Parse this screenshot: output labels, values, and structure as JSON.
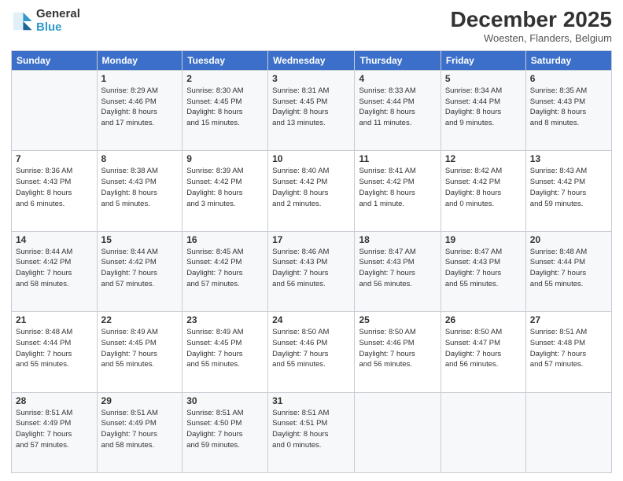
{
  "logo": {
    "general": "General",
    "blue": "Blue"
  },
  "title": {
    "main": "December 2025",
    "sub": "Woesten, Flanders, Belgium"
  },
  "calendar": {
    "headers": [
      "Sunday",
      "Monday",
      "Tuesday",
      "Wednesday",
      "Thursday",
      "Friday",
      "Saturday"
    ],
    "weeks": [
      [
        {
          "day": "",
          "info": ""
        },
        {
          "day": "1",
          "info": "Sunrise: 8:29 AM\nSunset: 4:46 PM\nDaylight: 8 hours\nand 17 minutes."
        },
        {
          "day": "2",
          "info": "Sunrise: 8:30 AM\nSunset: 4:45 PM\nDaylight: 8 hours\nand 15 minutes."
        },
        {
          "day": "3",
          "info": "Sunrise: 8:31 AM\nSunset: 4:45 PM\nDaylight: 8 hours\nand 13 minutes."
        },
        {
          "day": "4",
          "info": "Sunrise: 8:33 AM\nSunset: 4:44 PM\nDaylight: 8 hours\nand 11 minutes."
        },
        {
          "day": "5",
          "info": "Sunrise: 8:34 AM\nSunset: 4:44 PM\nDaylight: 8 hours\nand 9 minutes."
        },
        {
          "day": "6",
          "info": "Sunrise: 8:35 AM\nSunset: 4:43 PM\nDaylight: 8 hours\nand 8 minutes."
        }
      ],
      [
        {
          "day": "7",
          "info": "Sunrise: 8:36 AM\nSunset: 4:43 PM\nDaylight: 8 hours\nand 6 minutes."
        },
        {
          "day": "8",
          "info": "Sunrise: 8:38 AM\nSunset: 4:43 PM\nDaylight: 8 hours\nand 5 minutes."
        },
        {
          "day": "9",
          "info": "Sunrise: 8:39 AM\nSunset: 4:42 PM\nDaylight: 8 hours\nand 3 minutes."
        },
        {
          "day": "10",
          "info": "Sunrise: 8:40 AM\nSunset: 4:42 PM\nDaylight: 8 hours\nand 2 minutes."
        },
        {
          "day": "11",
          "info": "Sunrise: 8:41 AM\nSunset: 4:42 PM\nDaylight: 8 hours\nand 1 minute."
        },
        {
          "day": "12",
          "info": "Sunrise: 8:42 AM\nSunset: 4:42 PM\nDaylight: 8 hours\nand 0 minutes."
        },
        {
          "day": "13",
          "info": "Sunrise: 8:43 AM\nSunset: 4:42 PM\nDaylight: 7 hours\nand 59 minutes."
        }
      ],
      [
        {
          "day": "14",
          "info": "Sunrise: 8:44 AM\nSunset: 4:42 PM\nDaylight: 7 hours\nand 58 minutes."
        },
        {
          "day": "15",
          "info": "Sunrise: 8:44 AM\nSunset: 4:42 PM\nDaylight: 7 hours\nand 57 minutes."
        },
        {
          "day": "16",
          "info": "Sunrise: 8:45 AM\nSunset: 4:42 PM\nDaylight: 7 hours\nand 57 minutes."
        },
        {
          "day": "17",
          "info": "Sunrise: 8:46 AM\nSunset: 4:43 PM\nDaylight: 7 hours\nand 56 minutes."
        },
        {
          "day": "18",
          "info": "Sunrise: 8:47 AM\nSunset: 4:43 PM\nDaylight: 7 hours\nand 56 minutes."
        },
        {
          "day": "19",
          "info": "Sunrise: 8:47 AM\nSunset: 4:43 PM\nDaylight: 7 hours\nand 55 minutes."
        },
        {
          "day": "20",
          "info": "Sunrise: 8:48 AM\nSunset: 4:44 PM\nDaylight: 7 hours\nand 55 minutes."
        }
      ],
      [
        {
          "day": "21",
          "info": "Sunrise: 8:48 AM\nSunset: 4:44 PM\nDaylight: 7 hours\nand 55 minutes."
        },
        {
          "day": "22",
          "info": "Sunrise: 8:49 AM\nSunset: 4:45 PM\nDaylight: 7 hours\nand 55 minutes."
        },
        {
          "day": "23",
          "info": "Sunrise: 8:49 AM\nSunset: 4:45 PM\nDaylight: 7 hours\nand 55 minutes."
        },
        {
          "day": "24",
          "info": "Sunrise: 8:50 AM\nSunset: 4:46 PM\nDaylight: 7 hours\nand 55 minutes."
        },
        {
          "day": "25",
          "info": "Sunrise: 8:50 AM\nSunset: 4:46 PM\nDaylight: 7 hours\nand 56 minutes."
        },
        {
          "day": "26",
          "info": "Sunrise: 8:50 AM\nSunset: 4:47 PM\nDaylight: 7 hours\nand 56 minutes."
        },
        {
          "day": "27",
          "info": "Sunrise: 8:51 AM\nSunset: 4:48 PM\nDaylight: 7 hours\nand 57 minutes."
        }
      ],
      [
        {
          "day": "28",
          "info": "Sunrise: 8:51 AM\nSunset: 4:49 PM\nDaylight: 7 hours\nand 57 minutes."
        },
        {
          "day": "29",
          "info": "Sunrise: 8:51 AM\nSunset: 4:49 PM\nDaylight: 7 hours\nand 58 minutes."
        },
        {
          "day": "30",
          "info": "Sunrise: 8:51 AM\nSunset: 4:50 PM\nDaylight: 7 hours\nand 59 minutes."
        },
        {
          "day": "31",
          "info": "Sunrise: 8:51 AM\nSunset: 4:51 PM\nDaylight: 8 hours\nand 0 minutes."
        },
        {
          "day": "",
          "info": ""
        },
        {
          "day": "",
          "info": ""
        },
        {
          "day": "",
          "info": ""
        }
      ]
    ]
  }
}
